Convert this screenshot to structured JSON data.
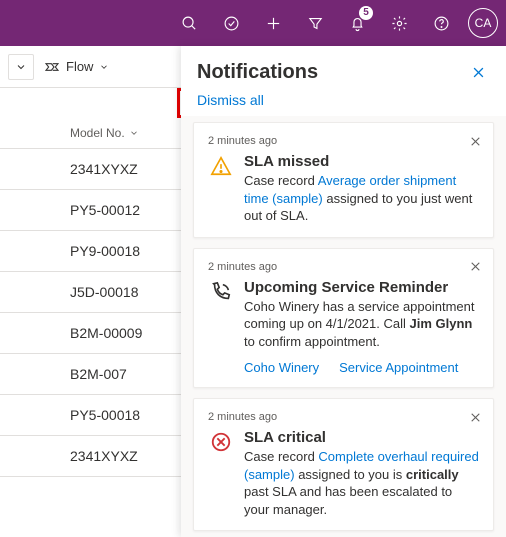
{
  "topbar": {
    "notification_count": "5",
    "avatar_initials": "CA"
  },
  "cmdbar": {
    "flow_label": "Flow"
  },
  "grid": {
    "header": "Model No.",
    "rows": [
      "2341XYXZ",
      "PY5-00012",
      "PY9-00018",
      "J5D-00018",
      "B2M-00009",
      "B2M-007",
      "PY5-00018",
      "2341XYXZ"
    ]
  },
  "panel": {
    "title": "Notifications",
    "dismiss_all": "Dismiss all"
  },
  "cards": [
    {
      "ts": "2 minutes ago",
      "title": "SLA missed",
      "pre": "Case record ",
      "link": "Average order shipment time (sample)",
      "post": " assigned to you just went out of SLA."
    },
    {
      "ts": "2 minutes ago",
      "title": "Upcoming Service Reminder",
      "line1": "Coho Winery has a service appointment coming up on 4/1/2021. Call ",
      "bold": "Jim Glynn",
      "line2": " to confirm appointment.",
      "linkA": "Coho Winery",
      "linkB": "Service Appointment"
    },
    {
      "ts": "2 minutes ago",
      "title": "SLA critical",
      "pre": "Case record ",
      "link": "Complete overhaul required (sample)",
      "mid": " assigned to you is ",
      "bold": "critically",
      "post": " past SLA and has been escalated to your manager."
    }
  ]
}
